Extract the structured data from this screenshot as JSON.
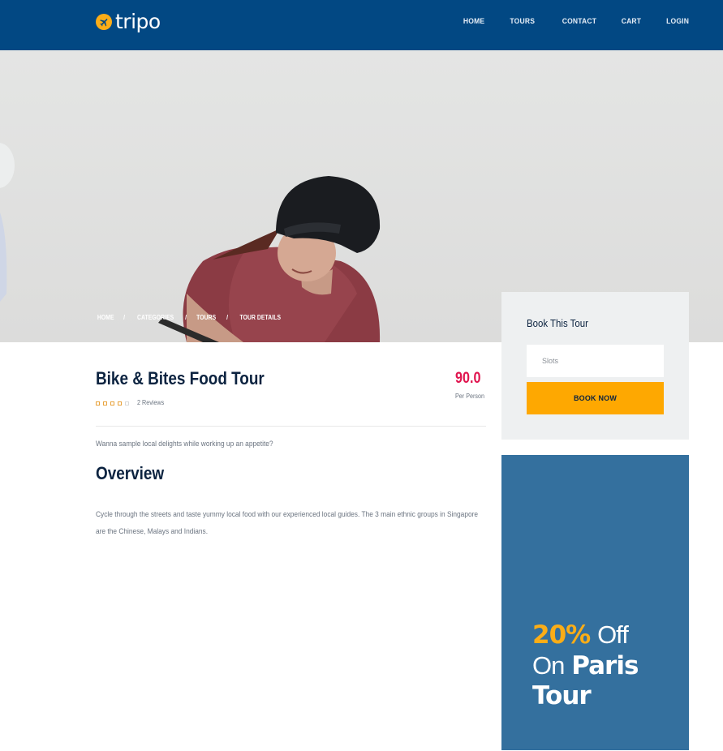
{
  "header": {
    "logo_text": "tripo",
    "nav": [
      "HOME",
      "TOURS",
      "CONTACT",
      "CART",
      "LOGIN"
    ]
  },
  "breadcrumb": [
    "HOME",
    "CATEGORIES",
    "TOURS",
    "TOUR DETAILS"
  ],
  "booking": {
    "title": "Book This Tour",
    "slots_placeholder": "Slots",
    "button_label": "BOOK NOW"
  },
  "tour": {
    "title": "Bike & Bites Food Tour",
    "rating": 0,
    "reviews": "2 Reviews",
    "price": "90.0",
    "price_unit": "Per Person",
    "tagline": "Wanna sample local delights while working up an appetite?",
    "overview_heading": "Overview",
    "description": "Cycle through the streets and taste yummy local food with our experienced local guides. The 3 main ethnic groups in Singapore are the Chinese, Malays and Indians."
  },
  "promo": {
    "percent": "20%",
    "off": "Off",
    "on": "On",
    "city": "Paris",
    "tour": "Tour"
  },
  "colors": {
    "header": "#024883",
    "accent": "#fea801",
    "price": "#e0154f",
    "promo_bg": "#34709e"
  }
}
